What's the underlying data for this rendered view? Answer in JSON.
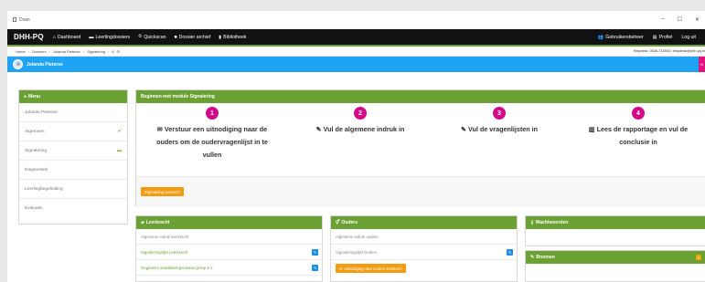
{
  "window": {
    "title": "Dvan",
    "controls": [
      "–",
      "☐",
      "✕"
    ]
  },
  "navbar": {
    "brand": "DHH-PQ",
    "items": [
      {
        "icon": "dashboard-icon",
        "glyph": "⌂",
        "label": "Dashboard"
      },
      {
        "icon": "folder-icon",
        "glyph": "▬",
        "label": "Leerlingdossiers"
      },
      {
        "icon": "clock-icon",
        "glyph": "⏲",
        "label": "Quickscan"
      },
      {
        "icon": "archive-icon",
        "glyph": "■",
        "label": "Dossier archief"
      },
      {
        "icon": "book-icon",
        "glyph": "▮",
        "label": "Bibliotheek"
      }
    ],
    "right_items": [
      {
        "icon": "users-icon",
        "glyph": "👥",
        "label": "Gebruikersbeheer"
      },
      {
        "icon": "profile-icon",
        "glyph": "▤",
        "label": "Profiel"
      },
      {
        "label": "Log uit"
      }
    ]
  },
  "breadcrumb": {
    "items": [
      "Home",
      "Dossiers",
      "Jolanda Pieterse",
      "Signalering",
      "6"
    ],
    "refresh_glyph": "⟳",
    "helpdesk": "Helpdesk: 0526-714592 / helpdesk@dhh-pq.nl"
  },
  "user": {
    "name": "Jolanda Pieterse",
    "pink_tab_label": "Hi"
  },
  "menu": {
    "title": "Menu",
    "items": [
      {
        "label": "Jolanda Pieterse",
        "mark": ""
      },
      {
        "label": "Algemeen",
        "mark": "✔"
      },
      {
        "label": "Signalering",
        "mark": "▬"
      },
      {
        "label": "Diagnostiek",
        "mark": ""
      },
      {
        "label": "Leerlingbegeleiding",
        "mark": ""
      },
      {
        "label": "Evaluatie",
        "mark": ""
      }
    ]
  },
  "signalering": {
    "title": "Beginnen met module Signalering",
    "steps": [
      {
        "num": "1",
        "icon": "envelope-icon",
        "glyph": "✉",
        "text": "Verstuur een uitnodiging naar de ouders om de oudervragenlijst in te vullen",
        "lines": [
          "Verstuur een uitnodiging naar de",
          "ouders om de oudervragenlijst in te",
          "vullen"
        ],
        "color": "#d3098a"
      },
      {
        "num": "2",
        "icon": "edit-icon",
        "glyph": "✎",
        "text": "Vul de algemene indruk in",
        "lines": [
          "Vul de algemene indruk in"
        ],
        "color": "#d3098a"
      },
      {
        "num": "3",
        "icon": "edit-icon",
        "glyph": "✎",
        "text": "Vul de vragenlijsten in",
        "lines": [
          "Vul de vragenlijsten in"
        ],
        "color": "#d3098a"
      },
      {
        "num": "4",
        "icon": "bar-chart-icon",
        "glyph": "▥",
        "text": "Lees de rapportage en vul de conclusie in",
        "lines": [
          "Lees de rapportage en vul de",
          "conclusie in"
        ],
        "color": "#d3098a"
      }
    ],
    "overview_button": "Signalering overzicht"
  },
  "leerkracht": {
    "title": "Leerkracht",
    "rows": [
      {
        "label": "Algemene indruk leerkracht",
        "style": "gray",
        "edit": false
      },
      {
        "label": "Signaleringslijst Leerkracht",
        "style": "green",
        "edit": true
      },
      {
        "label": "Gegevens ontwikkelingsniveau groep 1-2",
        "style": "green",
        "edit": true
      }
    ]
  },
  "ouders": {
    "title": "Ouders",
    "rows": [
      {
        "label": "Algemene indruk ouders",
        "style": "gray",
        "edit": false
      },
      {
        "label": "Signaleringslijst Ouders",
        "style": "gray",
        "edit": true
      }
    ],
    "invite_button": "Uitnodiging naar ouders versturen"
  },
  "wachtwoorden": {
    "title": "Wachtwoorden"
  },
  "bronnen": {
    "title": "Bronnen"
  }
}
